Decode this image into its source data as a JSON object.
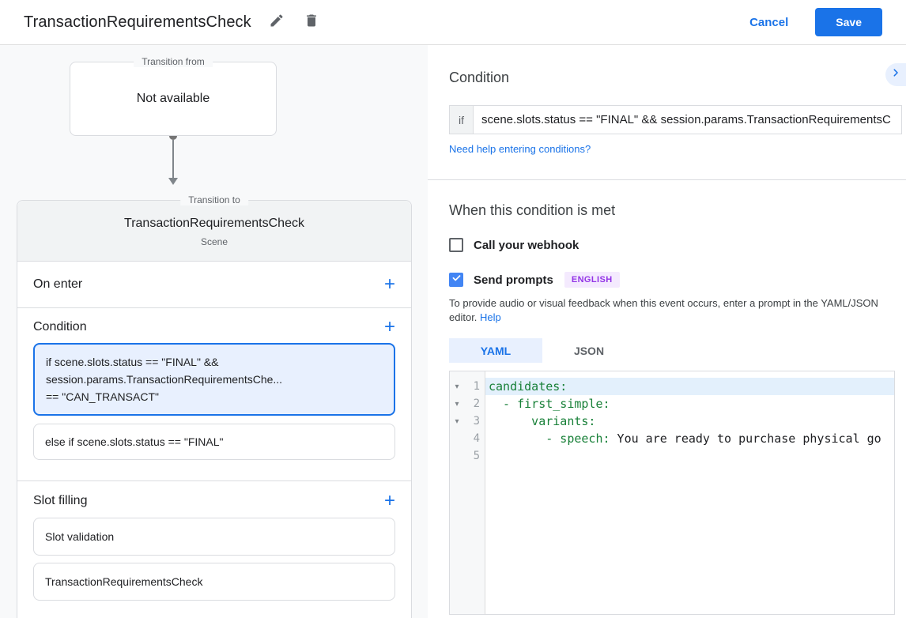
{
  "header": {
    "title": "TransactionRequirementsCheck",
    "cancel_label": "Cancel",
    "save_label": "Save"
  },
  "diagram": {
    "transition_from_label": "Transition from",
    "transition_from_value": "Not available",
    "transition_to_label": "Transition to",
    "scene_name": "TransactionRequirementsCheck",
    "scene_type": "Scene",
    "on_enter_label": "On enter",
    "condition_label": "Condition",
    "slot_filling_label": "Slot filling",
    "condition_cards": [
      {
        "selected": true,
        "line1": "if scene.slots.status == \"FINAL\" &&",
        "line2": "session.params.TransactionRequirementsChe...",
        "line3": "== \"CAN_TRANSACT\""
      },
      {
        "selected": false,
        "text": "else if scene.slots.status == \"FINAL\""
      }
    ],
    "slot_cards": [
      {
        "label": "Slot validation"
      },
      {
        "label": "TransactionRequirementsCheck"
      }
    ]
  },
  "panel": {
    "title": "Condition",
    "if_label": "if",
    "if_value": "scene.slots.status == \"FINAL\" && session.params.TransactionRequirementsC",
    "help_link": "Need help entering conditions?",
    "when_title": "When this condition is met",
    "webhook": {
      "label": "Call your webhook",
      "checked": false
    },
    "prompts": {
      "label": "Send prompts",
      "checked": true,
      "language_badge": "ENGLISH"
    },
    "prompt_help_text": "To provide audio or visual feedback when this event occurs, enter a prompt in the YAML/JSON editor.",
    "prompt_help_link": "Help",
    "tabs": [
      {
        "label": "YAML",
        "active": true
      },
      {
        "label": "JSON",
        "active": false
      }
    ]
  },
  "editor": {
    "language": "YAML",
    "highlighted_line": 1,
    "lines": [
      {
        "num": "1",
        "foldable": true,
        "key": "candidates:",
        "value": ""
      },
      {
        "num": "2",
        "foldable": true,
        "key": "  - first_simple:",
        "value": ""
      },
      {
        "num": "3",
        "foldable": true,
        "key": "      variants:",
        "value": ""
      },
      {
        "num": "4",
        "foldable": false,
        "key": "        - speech:",
        "value": " You are ready to purchase physical go"
      },
      {
        "num": "5",
        "foldable": false,
        "key": "",
        "value": ""
      }
    ]
  },
  "colors": {
    "accent_blue": "#1a73e8",
    "checkbox_blue": "#4285f4",
    "selected_card_bg": "#e8f0fe",
    "selected_card_border": "#1a73e8",
    "badge_text": "#9334e6",
    "badge_bg": "#f4eafe",
    "code_key_green": "#188038",
    "highlight_line_bg": "#e3f0fc",
    "panel_bg": "#f8f9fa"
  }
}
